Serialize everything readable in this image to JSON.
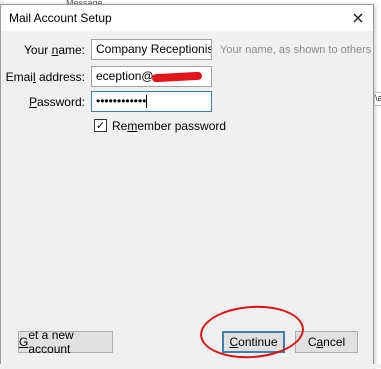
{
  "background": {
    "behind_text": "Message Storage",
    "right_edge_text": "\\a"
  },
  "dialog": {
    "title": "Mail Account Setup",
    "close_glyph": "×",
    "fields": {
      "name": {
        "label_pre": "Your ",
        "label_u": "n",
        "label_post": "ame:",
        "value": "Company Receptionist",
        "hint": "Your name, as shown to others"
      },
      "email": {
        "label_pre": "Emai",
        "label_u": "l",
        "label_post": " address:",
        "value": "eception@"
      },
      "password": {
        "label_pre": "",
        "label_u": "P",
        "label_post": "assword:",
        "value": "••••••••••••"
      }
    },
    "remember": {
      "checked_glyph": "✓",
      "label_pre": "Re",
      "label_u": "m",
      "label_post": "ember password",
      "checked": true
    },
    "buttons": {
      "new_account": {
        "label_pre": "",
        "label_u": "G",
        "label_post": "et a new account"
      },
      "continue": {
        "label_pre": "",
        "label_u": "C",
        "label_post": "ontinue"
      },
      "cancel": {
        "label_pre": "C",
        "label_u": "a",
        "label_post": "ncel"
      }
    },
    "annotation_color": "#e01010",
    "redaction_color": "#e0161b"
  }
}
